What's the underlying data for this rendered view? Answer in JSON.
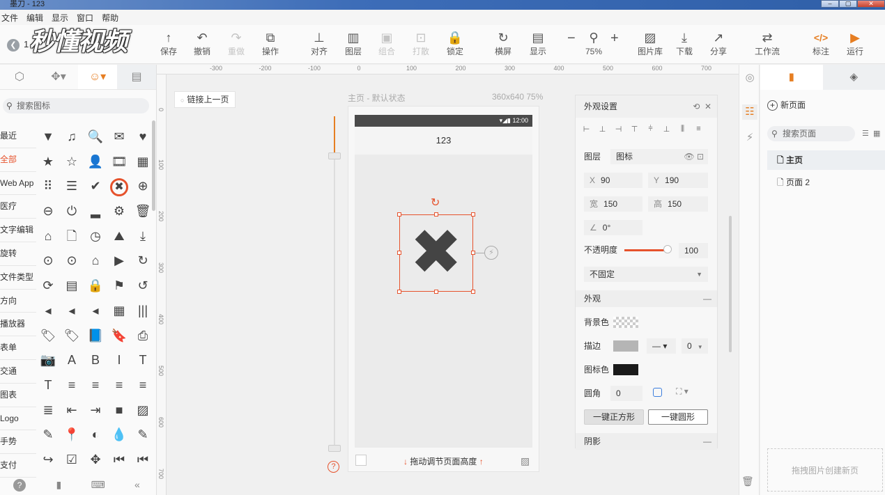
{
  "window": {
    "title": "墨刀 - 123",
    "controls": [
      "–",
      "▢",
      "✕"
    ]
  },
  "menu": [
    "文件",
    "编辑",
    "显示",
    "窗口",
    "帮助"
  ],
  "project": {
    "number": "1",
    "watermark": "秒懂视频"
  },
  "toolbar": [
    {
      "label": "保存",
      "icon": "↑"
    },
    {
      "label": "撤销",
      "icon": "↶"
    },
    {
      "label": "重做",
      "icon": "↷"
    },
    {
      "label": "操作",
      "icon": "⧉"
    },
    {
      "label": "对齐",
      "icon": "⊥"
    },
    {
      "label": "图层",
      "icon": "▥"
    },
    {
      "label": "组合",
      "icon": "▣"
    },
    {
      "label": "打散",
      "icon": "⊡"
    },
    {
      "label": "锁定",
      "icon": "🔒"
    },
    {
      "label": "横屏",
      "icon": "↻"
    },
    {
      "label": "显示",
      "icon": "▤"
    },
    {
      "label": "75%",
      "icon": "⚲"
    },
    {
      "label": "图片库",
      "icon": "▨"
    },
    {
      "label": "下载",
      "icon": "⤓"
    },
    {
      "label": "分享",
      "icon": "↗"
    },
    {
      "label": "工作流",
      "icon": "⇄"
    },
    {
      "label": "标注",
      "icon": "</>"
    },
    {
      "label": "运行",
      "icon": "▶"
    }
  ],
  "zoom": {
    "minus": "−",
    "plus": "+"
  },
  "left_panel": {
    "search_placeholder": "搜索图标",
    "categories": [
      "最近",
      "全部",
      "Web App",
      "医疗",
      "文字编辑",
      "旋转",
      "文件类型",
      "方向",
      "播放器",
      "表单",
      "交通",
      "图表",
      "Logo",
      "手势",
      "支付"
    ],
    "active_category": "全部",
    "icons": [
      "▼",
      "♫",
      "🔍",
      "✉",
      "♥",
      "★",
      "☆",
      "👤",
      "🎞",
      "▦",
      "⠿",
      "☰",
      "✔",
      "✖",
      "⊕",
      "⊖",
      "⏻",
      "▂",
      "⚙",
      "🗑",
      "⌂",
      "🗋",
      "◷",
      "⛰",
      "⤓",
      "⊙",
      "⊙",
      "⌂",
      "▶",
      "↻",
      "⟳",
      "▤",
      "🔒",
      "⚑",
      "↺",
      "◂",
      "◂",
      "◂",
      "▦",
      "|||",
      "🏷",
      "🏷",
      "📘",
      "🔖",
      "⎙",
      "📷",
      "A",
      "B",
      "I",
      "T",
      "T",
      "≡",
      "≡",
      "≡",
      "≡",
      "≣",
      "⇤",
      "⇥",
      "■",
      "▨",
      "✎",
      "📍",
      "◐",
      "💧",
      "✎",
      "↪",
      "☑",
      "✥",
      "⏮",
      "⏮"
    ],
    "bottom": [
      "?",
      "▮",
      "⌨",
      "«"
    ]
  },
  "ruler": {
    "h_labels": [
      "-300",
      "-200",
      "-100",
      "0",
      "100",
      "200",
      "300",
      "400",
      "500",
      "600",
      "700"
    ],
    "v_labels": [
      "0",
      "100",
      "200",
      "300",
      "400",
      "500",
      "600",
      "700"
    ]
  },
  "canvas": {
    "link_prev": "链接上一页",
    "page_state": "主页 - 默认状态",
    "page_size": "360x640 75%",
    "status_time": "12:00",
    "nav_title": "123",
    "drag_hint": "拖动调节页面高度",
    "help": "?"
  },
  "props": {
    "title": "外观设置",
    "layer_label": "图层",
    "layer_value": "图标",
    "x_label": "X",
    "x_value": "90",
    "y_label": "Y",
    "y_value": "190",
    "w_label": "宽",
    "w_value": "150",
    "h_label": "高",
    "h_value": "150",
    "angle_label": "∠",
    "angle_value": "0°",
    "opacity_label": "不透明度",
    "opacity_value": "100",
    "opacity_fraction": 1.0,
    "fixed_value": "不固定",
    "appearance_section": "外观",
    "bg_label": "背景色",
    "border_label": "描边",
    "border_width": "0",
    "icon_color_label": "图标色",
    "radius_label": "圆角",
    "radius_value": "0",
    "btn_square": "一键正方形",
    "btn_circle": "一键圆形",
    "shadow_section": "阴影",
    "colors": {
      "border": "#b5b5b5",
      "icon": "#1a1a1a",
      "accent": "#e6522c"
    }
  },
  "pages": {
    "new_page": "新页面",
    "search_placeholder": "搜索页面",
    "items": [
      "主页",
      "页面 2"
    ],
    "drop_hint": "拖拽图片创建新页"
  }
}
